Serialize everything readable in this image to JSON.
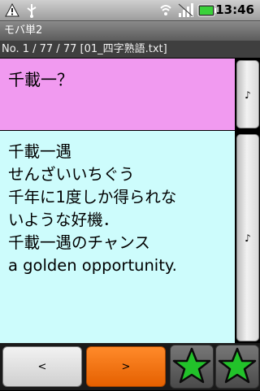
{
  "status_bar": {
    "time": "13:46",
    "icons": [
      "warning-icon",
      "usb-icon",
      "wifi-icon",
      "signal-icon",
      "battery-icon"
    ]
  },
  "app": {
    "title": "モバ単2"
  },
  "info_line": "No. 1 / 77 / 77 [01_四字熟語.txt]",
  "question": "千載一？",
  "answer_lines": [
    "千載一遇",
    "せんざいいちぐう",
    "千年に1度しか得られな",
    "いような好機．",
    "千載一遇のチャンス",
    "a golden opportunity."
  ],
  "side_buttons": {
    "top_label": "♪",
    "bottom_label": "♪"
  },
  "nav": {
    "prev_label": "<",
    "next_label": ">"
  },
  "colors": {
    "question_bg": "#f19af0",
    "answer_bg": "#cdfcfc",
    "next_button": "#ff7a1a",
    "star": "#22c22a"
  }
}
